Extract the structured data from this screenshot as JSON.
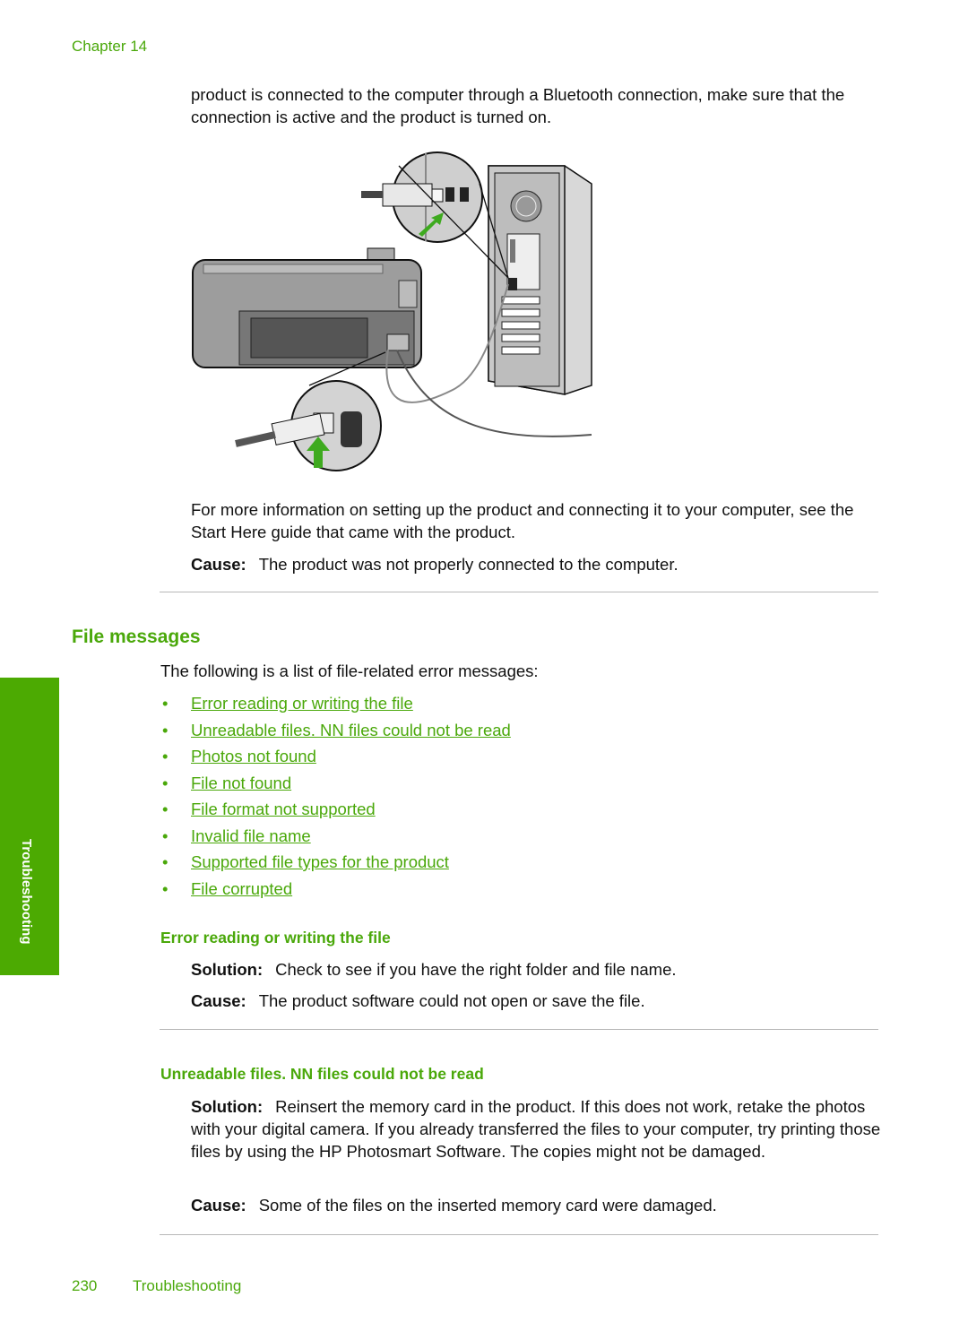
{
  "header": {
    "chapter": "Chapter 14"
  },
  "intro_paragraph": "product is connected to the computer through a Bluetooth connection, make sure that the connection is active and the product is turned on.",
  "figure": {
    "description": "Illustration of printer connected to computer with USB cable",
    "icons": [
      "printer-illustration",
      "computer-tower-illustration",
      "usb-plug-icon",
      "green-arrow-icon"
    ]
  },
  "more_info": "For more information on setting up the product and connecting it to your computer, see the Start Here guide that came with the product.",
  "cause_1": {
    "label": "Cause:",
    "text": "The product was not properly connected to the computer."
  },
  "section": {
    "title": "File messages",
    "intro": "The following is a list of file-related error messages:",
    "links": [
      "Error reading or writing the file",
      "Unreadable files. NN files could not be read",
      "Photos not found",
      "File not found",
      "File format not supported",
      "Invalid file name",
      "Supported file types for the product",
      "File corrupted"
    ]
  },
  "sub1": {
    "title": "Error reading or writing the file",
    "solution_label": "Solution:",
    "solution": "Check to see if you have the right folder and file name.",
    "cause_label": "Cause:",
    "cause": "The product software could not open or save the file."
  },
  "sub2": {
    "title": "Unreadable files. NN files could not be read",
    "solution_label": "Solution:",
    "solution": "Reinsert the memory card in the product. If this does not work, retake the photos with your digital camera. If you already transferred the files to your computer, try printing those files by using the HP Photosmart Software. The copies might not be damaged.",
    "cause_label": "Cause:",
    "cause": "Some of the files on the inserted memory card were damaged."
  },
  "side_tab": "Troubleshooting",
  "footer": {
    "page_number": "230",
    "title": "Troubleshooting"
  },
  "colors": {
    "accent": "#4aa80a",
    "tab": "#4caa02"
  }
}
